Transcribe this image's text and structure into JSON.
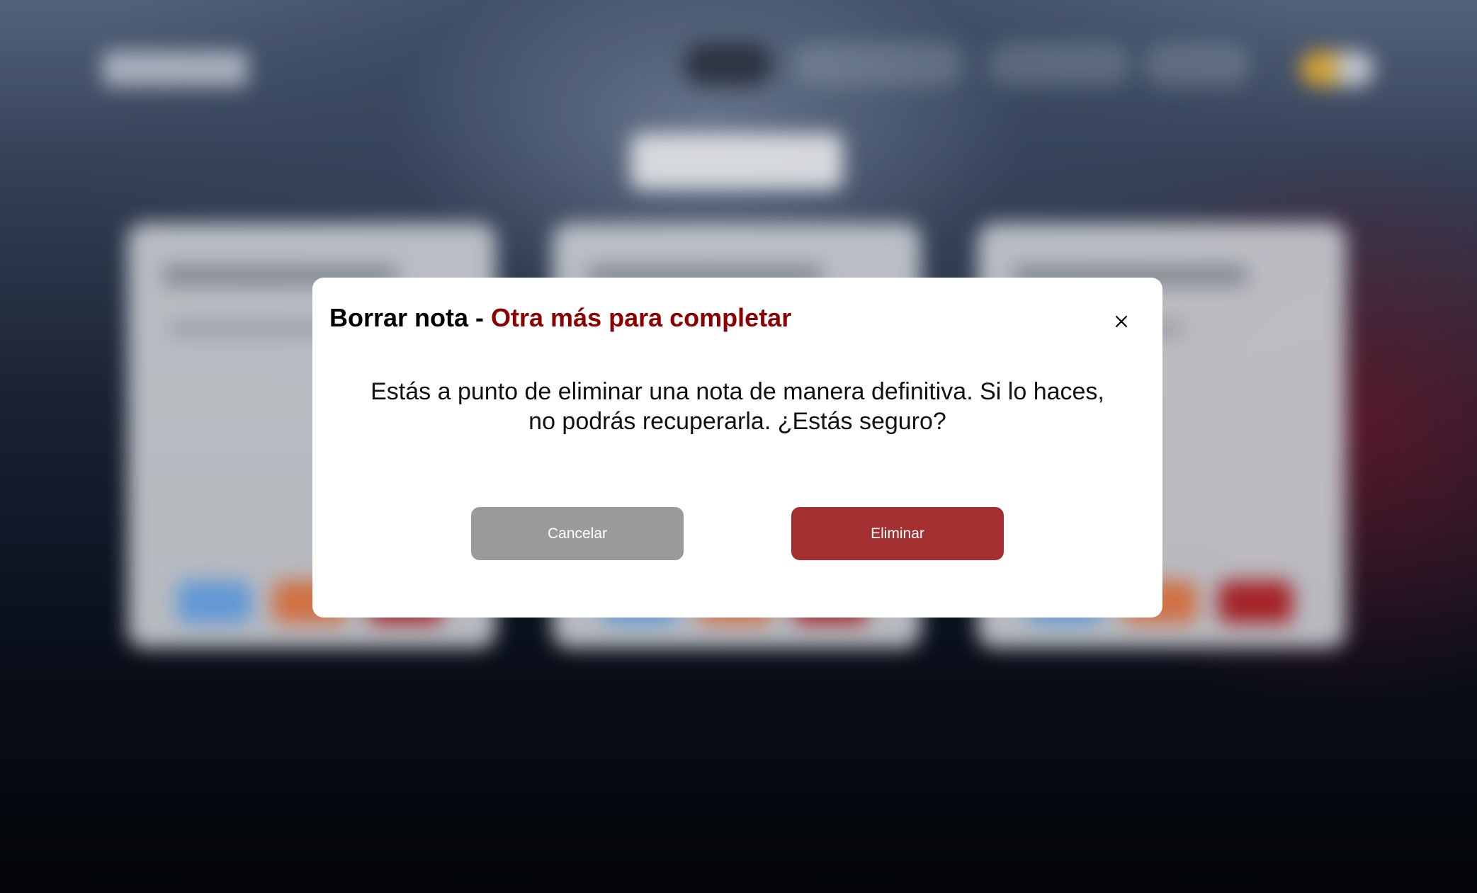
{
  "modal": {
    "title_prefix": "Borrar nota - ",
    "note_name": "Otra más para completar",
    "message": "Estás a punto de eliminar una nota de manera definitiva. Si lo haces, no podrás recuperarla. ¿Estás seguro?",
    "cancel_label": "Cancelar",
    "delete_label": "Eliminar",
    "close_icon": "close-icon"
  },
  "colors": {
    "note_name": "#8b0000",
    "cancel_button": "#9a9a9a",
    "delete_button": "#a32f31"
  }
}
